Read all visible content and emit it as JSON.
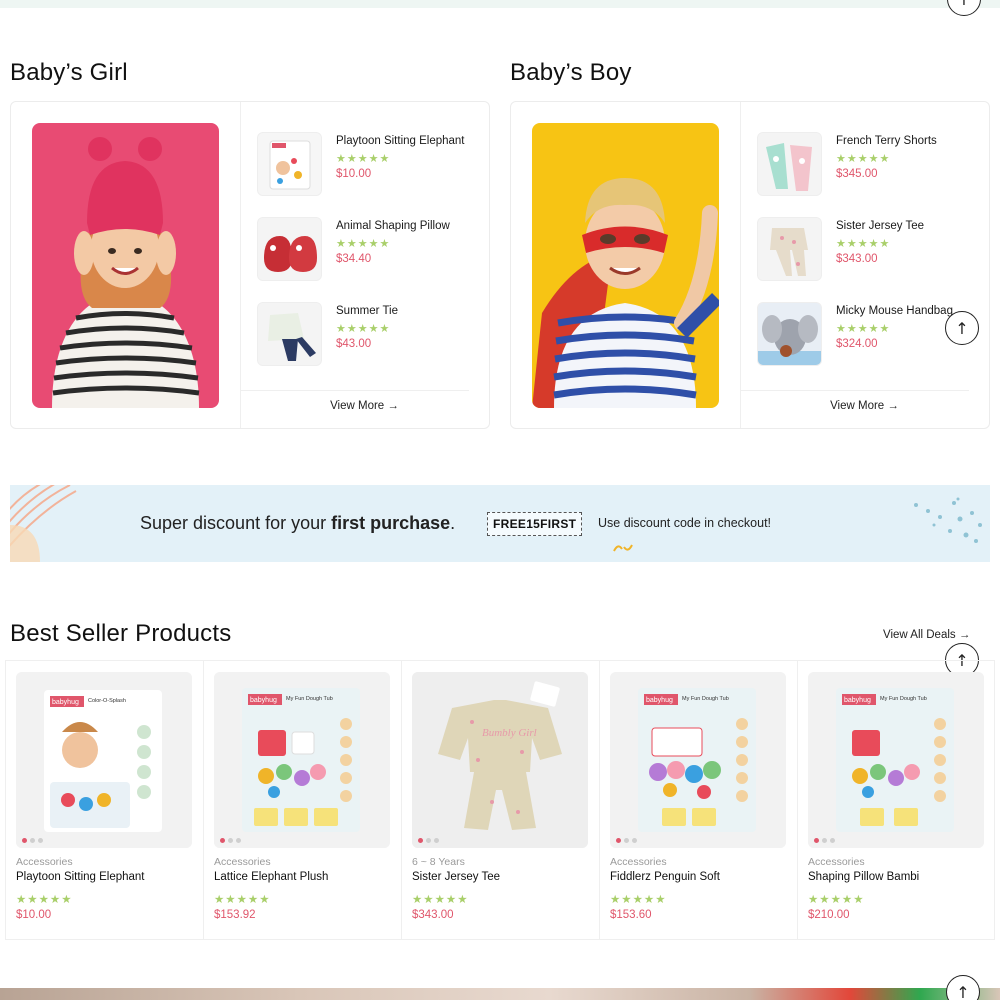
{
  "colors": {
    "price": "#e0566b",
    "stars": "#a9cf6a",
    "promo_bg": "#e3f1f8"
  },
  "icons": {
    "scroll_top": "arrow-up-icon",
    "arrow_right": "arrow-right-icon",
    "star": "star-icon"
  },
  "girl": {
    "title": "Baby’s Girl",
    "items": [
      {
        "name": "Playtoon Sitting Elephant",
        "price": "$10.00",
        "rating": 5
      },
      {
        "name": "Animal Shaping Pillow",
        "price": "$34.40",
        "rating": 5
      },
      {
        "name": "Summer Tie",
        "price": "$43.00",
        "rating": 5
      }
    ],
    "view_more": "View More"
  },
  "boy": {
    "title": "Baby’s Boy",
    "items": [
      {
        "name": "French Terry Shorts",
        "price": "$345.00",
        "rating": 5
      },
      {
        "name": "Sister Jersey Tee",
        "price": "$343.00",
        "rating": 5
      },
      {
        "name": "Micky Mouse Handbag",
        "price": "$324.00",
        "rating": 5
      }
    ],
    "view_more": "View More"
  },
  "promo": {
    "text_start": "Super discount for your ",
    "text_bold": "first purchase",
    "text_end": ".",
    "code": "FREE15FIRST",
    "hint": "Use discount code in checkout!"
  },
  "bestseller": {
    "title": "Best Seller Products",
    "view_all": "View All Deals",
    "products": [
      {
        "category": "Accessories",
        "name": "Playtoon Sitting Elephant",
        "price": "$10.00",
        "rating": 5
      },
      {
        "category": "Accessories",
        "name": "Lattice Elephant Plush",
        "price": "$153.92",
        "rating": 5
      },
      {
        "category": "6 ~ 8 Years",
        "name": "Sister Jersey Tee",
        "price": "$343.00",
        "rating": 5
      },
      {
        "category": "Accessories",
        "name": "Fiddlerz Penguin Soft",
        "price": "$153.60",
        "rating": 5
      },
      {
        "category": "Accessories",
        "name": "Shaping Pillow Bambi",
        "price": "$210.00",
        "rating": 5
      }
    ],
    "box_brand": "babyhug",
    "box_labels": [
      "Color-O-Splash",
      "My Fun Dough Tub",
      "Bumbly Girl",
      "My Fun Dough Tub",
      "My Fun Dough Tub"
    ]
  }
}
